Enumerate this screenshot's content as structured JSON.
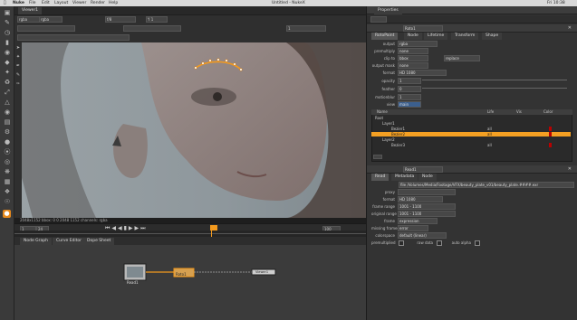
{
  "mac_menubar": {
    "app_name": "Nuke",
    "items": [
      "File",
      "Edit",
      "Layout",
      "Viewer",
      "Render",
      "Help"
    ],
    "title": "Untitled - NukeX",
    "clock": "Fri 10:38"
  },
  "viewer": {
    "tab_label": "Viewer1",
    "channel": "rgba",
    "layer": "rgba",
    "gain_label": "f/8",
    "gamma_label": "Y 1",
    "frame_label": "1",
    "info_bar": "2048x1152  bbox: 0 0 2048 1152  channels: rgba",
    "frame_field": "1",
    "end_frame": "100",
    "fps_label": "24"
  },
  "node_graph": {
    "tabs": [
      "Node Graph",
      "Curve Editor",
      "Dope Sheet"
    ],
    "nodes": [
      "Read1",
      "Roto1",
      "Viewer1"
    ]
  },
  "properties": {
    "tab_label": "Properties",
    "roto_node": {
      "name": "Roto1",
      "tabs": [
        "RotoPaint",
        "Node",
        "Lifetime",
        "Transform",
        "Shape"
      ],
      "rows": [
        {
          "label": "output",
          "value": "rgba"
        },
        {
          "label": "premultiply",
          "value": "none"
        },
        {
          "label": "clip to",
          "value": "bbox"
        },
        {
          "label": "output mask",
          "value": "none"
        },
        {
          "label": "format",
          "value": "HD 1080"
        },
        {
          "label": "opacity",
          "value": "1"
        },
        {
          "label": "feather",
          "value": "0"
        },
        {
          "label": "motionblur",
          "value": "1"
        },
        {
          "label": "view",
          "value": "main"
        }
      ],
      "cliptype_label": "replace",
      "tree_headers": [
        "Name",
        "Life",
        "Vis",
        "Color"
      ],
      "tree_rows": [
        {
          "name": "Root",
          "life": "",
          "selected": false
        },
        {
          "name": "Layer1",
          "life": "",
          "selected": false
        },
        {
          "name": "Bezier1",
          "life": "all",
          "selected": false
        },
        {
          "name": "Bezier2",
          "life": "all",
          "selected": true
        },
        {
          "name": "Layer2",
          "life": "",
          "selected": false
        },
        {
          "name": "Bezier3",
          "life": "all",
          "selected": false
        }
      ]
    },
    "read_node": {
      "name": "Read1",
      "tabs": [
        "Read",
        "Metadata",
        "Node"
      ],
      "file_path": "file  /Volumes/Media/Footage/VFX/beauty_plate_v01/beauty_plate.####.exr",
      "rows": [
        {
          "label": "proxy",
          "value": ""
        },
        {
          "label": "format",
          "value": "HD 1080"
        },
        {
          "label": "frame range",
          "value": "1001  -  1100"
        },
        {
          "label": "original range",
          "value": "1001  -  1100"
        },
        {
          "label": "frame",
          "value": "expression"
        },
        {
          "label": "missing frames",
          "value": "error"
        },
        {
          "label": "colorspace",
          "value": "default (linear)"
        },
        {
          "label": "premultiplied",
          "value": ""
        },
        {
          "label": "raw data",
          "value": ""
        },
        {
          "label": "auto alpha",
          "value": ""
        }
      ]
    }
  },
  "colors": {
    "accent": "#f39a1e",
    "selection": "#f4a023",
    "background": "#2b2b2b"
  }
}
